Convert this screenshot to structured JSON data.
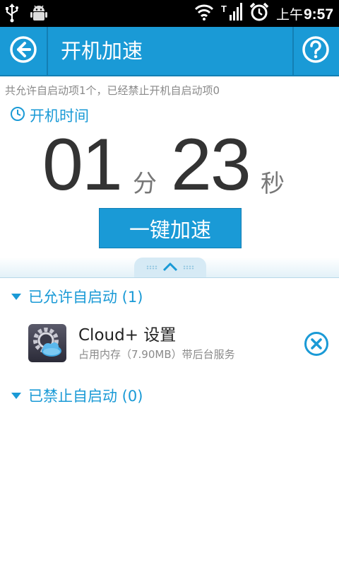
{
  "status_bar": {
    "ampm": "上午",
    "time": "9:57",
    "icons": [
      "usb-icon",
      "android-debug-icon",
      "wifi-icon",
      "signal-icon",
      "alarm-icon"
    ]
  },
  "header": {
    "title": "开机加速",
    "back_icon": "back-arrow-icon",
    "help_icon": "help-icon"
  },
  "summary_text": "共允许自启动项1个，已经禁止开机自启动项0",
  "boot_time": {
    "label": "开机时间",
    "minutes": "01",
    "minutes_unit": "分",
    "seconds": "23",
    "seconds_unit": "秒"
  },
  "speedup_button": "一键加速",
  "sections": {
    "allowed": {
      "title": "已允许自启动 (1)",
      "items": [
        {
          "name": "Cloud+ 设置",
          "subtitle": "占用内存（7.90MB）带后台服务",
          "icon": "cloud-settings-icon"
        }
      ]
    },
    "blocked": {
      "title": "已禁止自启动 (0)",
      "items": []
    }
  },
  "colors": {
    "accent": "#1a9ad6",
    "accent_dark": "#137fb4",
    "text_dark": "#333333",
    "text_muted": "#8a8a8a"
  }
}
